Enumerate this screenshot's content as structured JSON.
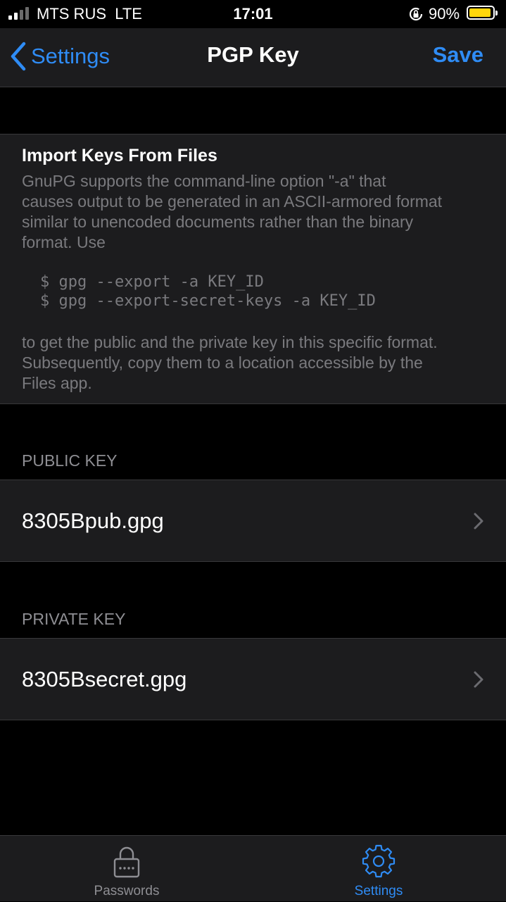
{
  "status_bar": {
    "carrier": "MTS RUS  LTE",
    "time": "17:01",
    "battery_percent": "90%",
    "signal_bars_filled": 2,
    "signal_bars_total": 4,
    "battery_level": 0.9,
    "battery_color": "#ffd60a"
  },
  "navbar": {
    "back_label": "Settings",
    "title": "PGP Key",
    "save_label": "Save",
    "accent_color": "#2f8cf5"
  },
  "info": {
    "title": "Import Keys From Files",
    "intro": "GnuPG supports the command-line option \"-a\" that\ncauses output to be generated in an ASCII-armored format\nsimilar to unencoded documents rather than the binary\nformat. Use",
    "code_line_1": "$ gpg --export -a KEY_ID",
    "code_line_2": "$ gpg --export-secret-keys -a KEY_ID",
    "outro": "to get the public and the private key in this specific format.\nSubsequently, copy them to a location accessible by the\nFiles app."
  },
  "public_key": {
    "header": "PUBLIC KEY",
    "file": "8305Bpub.gpg"
  },
  "private_key": {
    "header": "PRIVATE KEY",
    "file": "8305Bsecret.gpg"
  },
  "tabs": [
    {
      "label": "Passwords",
      "icon": "lock-icon",
      "selected": false
    },
    {
      "label": "Settings",
      "icon": "gear-icon",
      "selected": true
    }
  ]
}
